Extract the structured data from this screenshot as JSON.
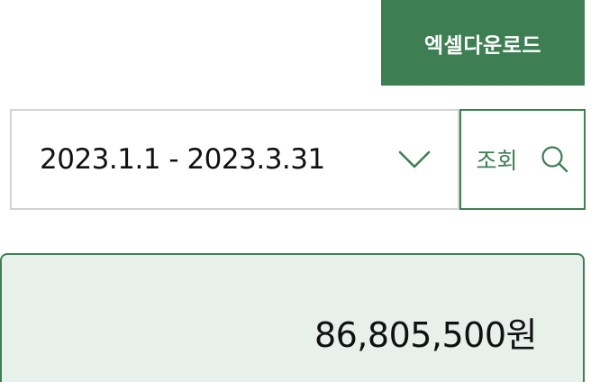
{
  "toolbar": {
    "excel_download_label": "엑셀다운로드"
  },
  "filter": {
    "date_range_value": "2023.1.1 - 2023.3.31",
    "search_label": "조회"
  },
  "summary": {
    "total_amount": "86,805,500원"
  },
  "icons": {
    "dropdown": "chevron-down-icon",
    "search": "search-icon"
  },
  "colors": {
    "accent": "#3d7f52",
    "panel_background": "#e8f0eb",
    "border_gray": "#d3d3d3",
    "text": "#111111"
  }
}
